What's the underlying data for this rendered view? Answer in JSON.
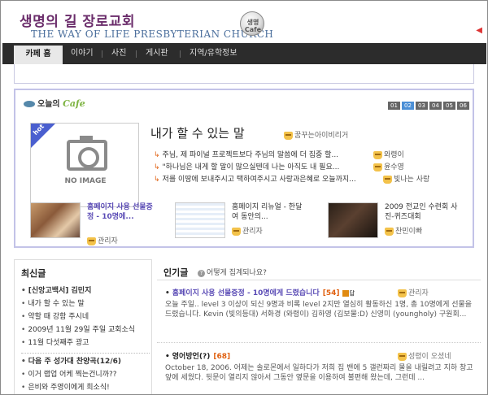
{
  "header": {
    "logo_ko": "생명의 길 장로교회",
    "logo_en": "THE WAY OF LIFE PRESBYTERIAN CHURCH",
    "cafe_cup_line1": "생명",
    "cafe_cup_line2": "Cafe"
  },
  "nav": {
    "tabs": [
      {
        "label": "카페 홈",
        "active": true
      },
      {
        "label": "이야기"
      },
      {
        "label": "사진"
      },
      {
        "label": "게시판"
      },
      {
        "label": "지역/유학정보"
      }
    ]
  },
  "today": {
    "title_ko": "오늘의",
    "title_cafe": "Cafe",
    "pages": [
      "01",
      "02",
      "03",
      "04",
      "05",
      "06"
    ],
    "active_page": "02",
    "hot_label": "hot",
    "no_image": "NO IMAGE",
    "featured_title": "내가 할 수 있는 말",
    "featured_author": "꿈꾸는아이비리거",
    "replies": [
      {
        "text": "주님, 제 파이널 프로젝트보다 주님의 말씀에 더 집중 할...",
        "user": "와령이"
      },
      {
        "text": "\"하나님은 내게 할 말이 많으실텐데 나는 아직도 내 필요...",
        "user": "윤수영"
      },
      {
        "text": "저를 이땅에 보내주시고 택하여주시고 사랑과은혜로 오늘까지...",
        "user": "빛나는 사랑"
      }
    ],
    "mini_posts": [
      {
        "title": "홈페이지 사용 선물증정 - 10명에...",
        "user": "관리자"
      },
      {
        "title": "홈페이지 리뉴얼 - 한달여 동안의...",
        "user": "관리자"
      },
      {
        "title": "2009 전교인 수련회 사진-퀴즈대회",
        "user": "찬민이빠"
      }
    ]
  },
  "recent": {
    "heading": "최신글",
    "group1": [
      {
        "text": "[신앙고백서] 김민지",
        "bold": true
      },
      {
        "text": "내가 할 수 있는 말"
      },
      {
        "text": "약할 때 강함 주시네"
      },
      {
        "text": "2009년 11월 29일 주일 교회소식"
      },
      {
        "text": "11월 다섯째주 광고"
      }
    ],
    "group2": [
      {
        "text": "다음 주 성가대 찬양곡(12/6)",
        "bold": true
      },
      {
        "text": "이거 랩업 어케 찍는건니까??"
      },
      {
        "text": "은비와 주영이에게 희소식!"
      }
    ]
  },
  "popular": {
    "heading": "인기글",
    "question": "어떻게 집계되나요?",
    "post1": {
      "title": "홈페이지 사용 선물증정 - 10명에게 드렸습니다",
      "count": "[54]",
      "badge": "답",
      "user": "관리자",
      "body": "오늘 주일.. level 3 이상이 되신 9명과 비록 level 2지만 열심히 활동하신 1명, 총 10명에게 선물을 드렸습니다. Kevin (빛의등대) 서화경 (와령이) 김하영 (김보물:D) 신영미 (youngholy) 구원회..."
    },
    "post2": {
      "title": "영어방언(?)",
      "count": "[68]",
      "user": "성령이 오셨네",
      "body": "October 18, 2006. 어제는 솔로몬에서 일하다가 저희 집 밴에 5 갤런짜리 물을 내릴려고 지하 창고 앞에 세웠다. 뒷문이 열리지 않아서 그동안 옆문을 이용하여 불편해 왔는데, 그런데 ..."
    }
  },
  "colors": {
    "nav_bg": "#2c2c2c",
    "accent_purple": "#5a4bb5",
    "accent_orange": "#e06010",
    "page_active": "#4b8fd6"
  }
}
